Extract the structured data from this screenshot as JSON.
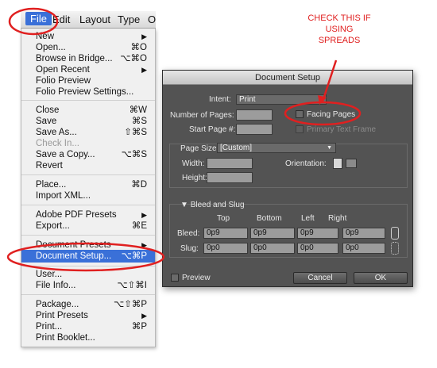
{
  "menubar": {
    "items": [
      "File",
      "Edit",
      "Layout",
      "Type",
      "O"
    ]
  },
  "menu": {
    "items": [
      {
        "label": "New",
        "submenu": true
      },
      {
        "label": "Open...",
        "shortcut": "⌘O"
      },
      {
        "label": "Browse in Bridge...",
        "shortcut": "⌥⌘O"
      },
      {
        "label": "Open Recent",
        "submenu": true
      },
      {
        "label": "Folio Preview"
      },
      {
        "label": "Folio Preview Settings..."
      },
      {
        "label": "Close",
        "shortcut": "⌘W"
      },
      {
        "label": "Save",
        "shortcut": "⌘S"
      },
      {
        "label": "Save As...",
        "shortcut": "⇧⌘S"
      },
      {
        "label": "Check In...",
        "disabled": true
      },
      {
        "label": "Save a Copy...",
        "shortcut": "⌥⌘S"
      },
      {
        "label": "Revert"
      },
      {
        "label": "Place...",
        "shortcut": "⌘D"
      },
      {
        "label": "Import XML..."
      },
      {
        "label": "Adobe PDF Presets",
        "submenu": true
      },
      {
        "label": "Export...",
        "shortcut": "⌘E"
      },
      {
        "label": "Document Presets",
        "submenu": true
      },
      {
        "label": "Document Setup...",
        "shortcut": "⌥⌘P",
        "highlighted": true
      },
      {
        "label": "User..."
      },
      {
        "label": "File Info...",
        "shortcut": "⌥⇧⌘I"
      },
      {
        "label": "Package...",
        "shortcut": "⌥⇧⌘P"
      },
      {
        "label": "Print Presets",
        "submenu": true
      },
      {
        "label": "Print...",
        "shortcut": "⌘P"
      },
      {
        "label": "Print Booklet..."
      }
    ]
  },
  "dialog": {
    "title": "Document Setup",
    "intent_label": "Intent:",
    "intent_value": "Print",
    "pages_label": "Number of Pages:",
    "start_label": "Start Page #:",
    "facing_pages_label": "Facing Pages",
    "primary_text_frame_label": "Primary Text Frame",
    "page_size_label": "Page Size:",
    "page_size_value": "[Custom]",
    "width_label": "Width:",
    "height_label": "Height:",
    "orientation_label": "Orientation:",
    "bleed_slug_label": "Bleed and Slug",
    "columns": [
      "Top",
      "Bottom",
      "Left",
      "Right"
    ],
    "bleed_label": "Bleed:",
    "bleed_values": [
      "0p9",
      "0p9",
      "0p9",
      "0p9"
    ],
    "slug_label": "Slug:",
    "slug_values": [
      "0p0",
      "0p0",
      "0p0",
      "0p0"
    ],
    "preview_label": "Preview",
    "cancel_label": "Cancel",
    "ok_label": "OK"
  },
  "annotation": {
    "text": "CHECK THIS IF USING SPREADS",
    "color": "#e02020"
  },
  "colors": {
    "menu_highlight": "#3a70d8",
    "dialog_bg": "#535353",
    "annotation": "#e02020"
  }
}
